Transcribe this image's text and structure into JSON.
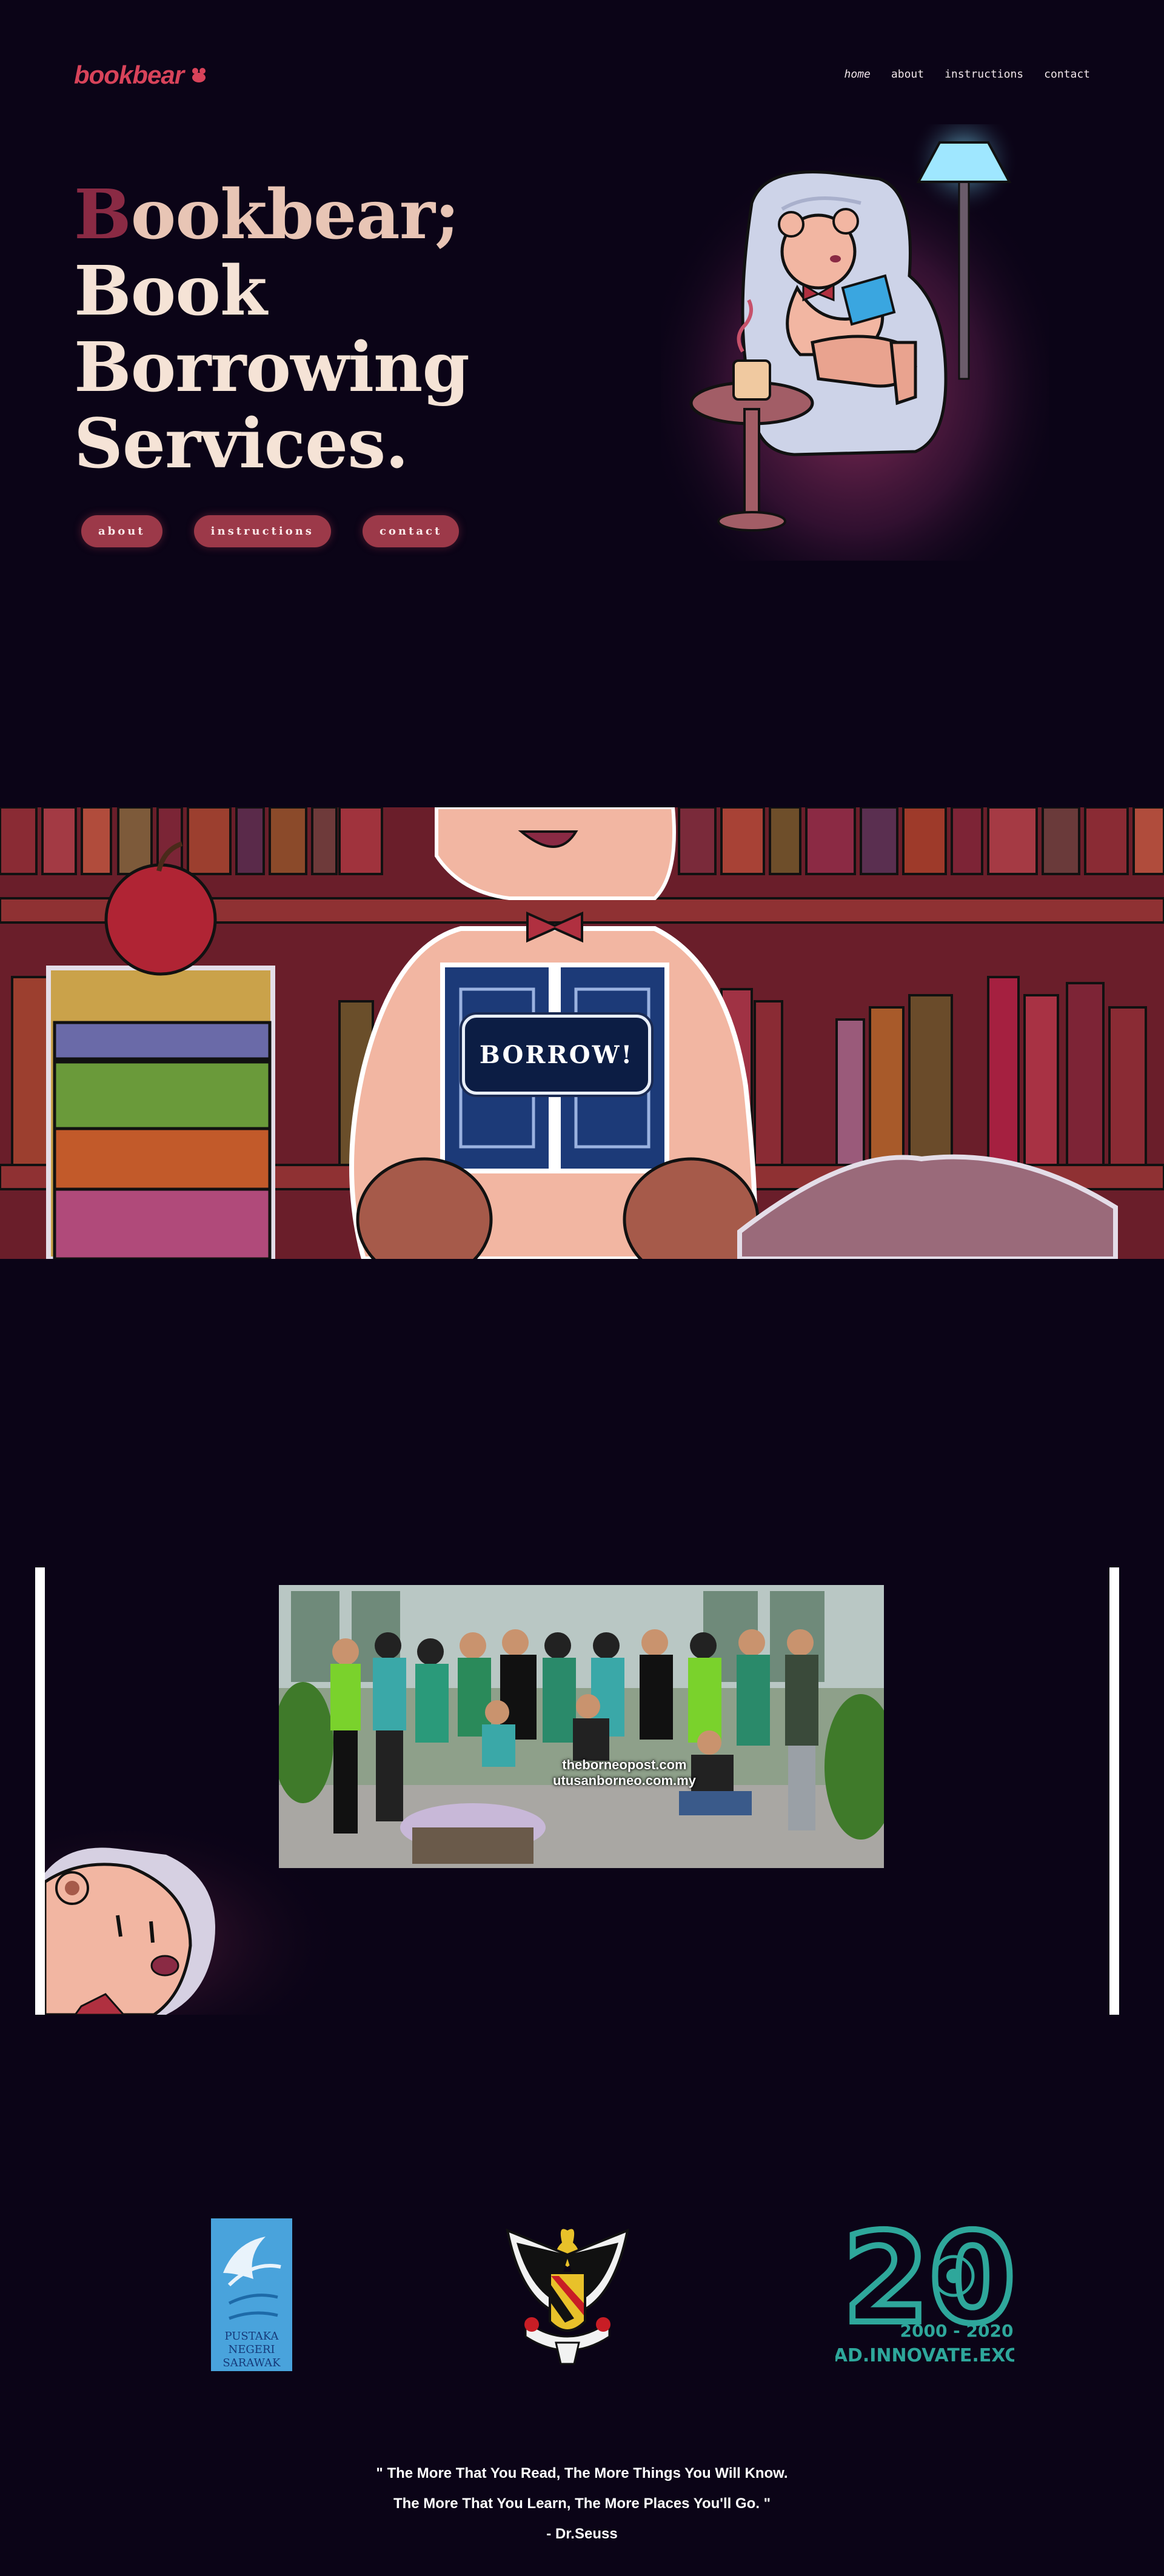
{
  "header": {
    "brand": "bookbear",
    "nav": [
      "home",
      "about",
      "instructions",
      "contact"
    ]
  },
  "hero": {
    "title_b": "B",
    "title_rest": "ookbear;",
    "title_lines": [
      "Book",
      "Borrowing",
      "Services."
    ],
    "buttons": [
      "about",
      "instructions",
      "contact"
    ]
  },
  "banner": {
    "cta": "BORROW!"
  },
  "photo": {
    "watermark_lines": [
      "theborneopost.com",
      "utusanborneo.com.my"
    ]
  },
  "logos": {
    "pustaka_lines": [
      "PUSTAKA",
      "NEGERI",
      "SARAWAK"
    ],
    "twenty": "20",
    "twenty_years": "2000 - 2020",
    "twenty_tagline": "READ.INNOVATE.EXCEL"
  },
  "quote": {
    "line1": "\" The More That You Read, The More Things You Will Know.",
    "line2": "The More That You Learn, The More Places You'll Go. \"",
    "author": "- Dr.Seuss"
  },
  "colors": {
    "background": "#0b0417",
    "accent": "#d8435a",
    "pill": "#9c3949",
    "teal": "#2ea79b"
  }
}
